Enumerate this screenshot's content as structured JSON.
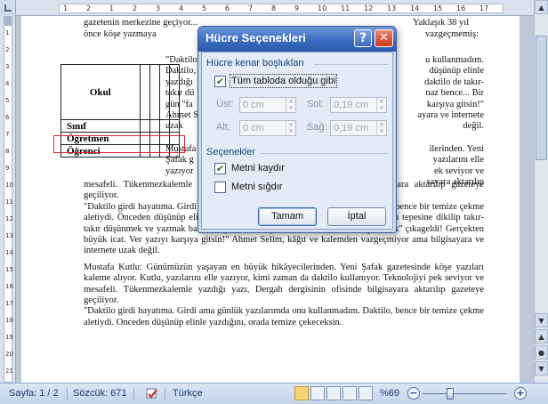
{
  "document": {
    "line0": "gazetenin merkezine geçiyor...",
    "line0b": "Yaklaşık 38 yıl",
    "line1": "önce köşe yazmaya",
    "line1b": "vazgeçmemiş:",
    "right_column": [
      "\"Daktilo",
      "Daktilo,",
      "yazdığı",
      "takır dü",
      "gün \"fa",
      "Ahmet S",
      "uzak"
    ],
    "right_column_tail": [
      "u kullanmadım.",
      "düşünüp elinle",
      "daktilo de takır-",
      "naz bence... Bir",
      "karşıya gitsin!\"",
      "ayara ve internete",
      "değil."
    ],
    "mid_fragments": [
      "Mustafa",
      "Şafak g",
      "yazıyor",
      "ilerinden. Yeni",
      "yazılarını elle",
      "ek seviyor ve",
      "sayara aktarılıp"
    ],
    "table": {
      "okul": "Okul",
      "sinif": "Sınıf",
      "ogretmen": "Öğretmen",
      "ogrenci": "Öğrenci"
    },
    "paragraphs": [
      "mesafeli. Tükenmezkalemle yazdığı yazı, Dergah dergisinin ofisinde bilgisayara aktarılıp gazeteye geçiliyor.",
      "\"Daktilo girdi hayatıma. Girdi ama günlük yazılarımda onu kullanmadım. Daktilo, bence bir temize çekme aletiydi. Önceden düşünüp elinle yazdığını, orada temize çekeceksin. Sandalyenin tepesine dikilip takır-takır düşünmek ve yazmak bana zor gelir. Mektup bile olmaz bence... Bir gün \"fax\" çıkageldi! Gerçekten büyük icat. Ver yazıyı karşıya gitsin!\" Ahmet Selim, kâğıt ve kalemden vazgeçmiyor ama bilgisayara ve internete uzak değil.",
      "Mustafa Kutlu: Günümüzün yaşayan en büyük hikâyecilerinden. Yeni Şafak gazetesinde köşe yazıları kaleme alıyor. Kutlu, yazılarını elle yazıyor, kimi zaman da daktilo kullanıyor. Teknolojiyi pek seviyor ve mesafeli. Tükenmezkalemle yazdığı yazı, Dergah dergisinin ofisinde bilgisayara aktarılıp gazeteye geçiliyor.",
      "\"Daktilo girdi hayatıma. Girdi ama günlük yazılarımda onu kullanmadım. Daktilo, bence bir temize çekme aletiydi. Onceden düşünüp elinle yazdığını, orada temize çekeceksin."
    ]
  },
  "ruler": {
    "ticks": [
      "1",
      "2",
      "1",
      "2",
      "3",
      "4",
      "5",
      "6",
      "7",
      "8",
      "9",
      "10",
      "11",
      "12",
      "13",
      "14",
      "15",
      "16",
      "17"
    ],
    "vticks": [
      "1",
      "2",
      "3",
      "4",
      "5",
      "6",
      "7",
      "8",
      "9",
      "10",
      "11",
      "12",
      "13",
      "14",
      "15",
      "16",
      "17",
      "18",
      "19",
      "20",
      "21"
    ]
  },
  "dialog": {
    "title": "Hücre Seçenekleri",
    "help_label": "?",
    "close_label": "✕",
    "section_margins": "Hücre kenar boşlukları",
    "same_as_table": "Tüm tabloda olduğu gibi",
    "same_as_table_checked": true,
    "top_label": "Üst:",
    "top_value": "0 cm",
    "left_label": "Sol:",
    "left_value": "0,19 cm",
    "bottom_label": "Alt:",
    "bottom_value": "0 cm",
    "right_label": "Sağ:",
    "right_value": "0,19 cm",
    "section_options": "Seçenekler",
    "wrap_text": "Metni kaydır",
    "wrap_text_checked": true,
    "fit_text": "Metni sığdır",
    "fit_text_checked": false,
    "ok": "Tamam",
    "cancel": "İptal"
  },
  "statusbar": {
    "page": "Sayfa: 1 / 2",
    "words": "Sözcük: 671",
    "language": "Türkçe",
    "zoom": "%69",
    "zoom_level": 0.69
  },
  "colors": {
    "title_bar": "#3b6cc2",
    "close_button": "#c73a19",
    "check": "#1d7a1d",
    "highlight_box": "#dd2233"
  }
}
